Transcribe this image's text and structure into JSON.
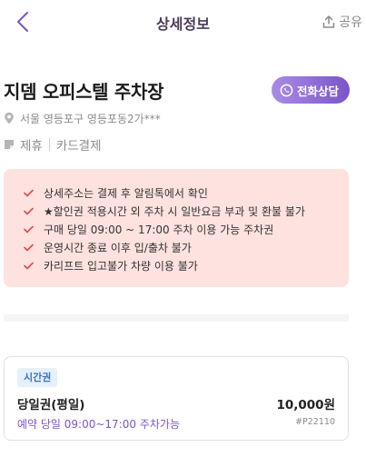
{
  "header": {
    "title": "상세정보",
    "share_label": "공유",
    "back_icon": "chevron-left-icon",
    "share_icon": "share-upload-icon",
    "accent_color": "#7b55c8"
  },
  "lot": {
    "name": "지뎀 오피스텔 주차장",
    "call_button_label": "전화상담",
    "call_icon": "phone-icon",
    "address": "서울 영등포구 영등포동2가***",
    "tags": [
      "제휴",
      "카드결제"
    ]
  },
  "notices": [
    "상세주소는 결제 후 알림톡에서 확인",
    "★할인권 적용시간 외 주차 시 일반요금 부과 및 환불 불가",
    "구매 당일 09:00 ~ 17:00 주차 이용 가능 주차권",
    "운영시간 종료 이후 입/출차 불가",
    "카리프트 입고불가 차량 이용 불가"
  ],
  "ticket": {
    "badge": "시간권",
    "name": "당일권(평일)",
    "price": "10,000원",
    "hours": "예약 당일 09:00~17:00 주차가능",
    "code": "#P22110"
  }
}
